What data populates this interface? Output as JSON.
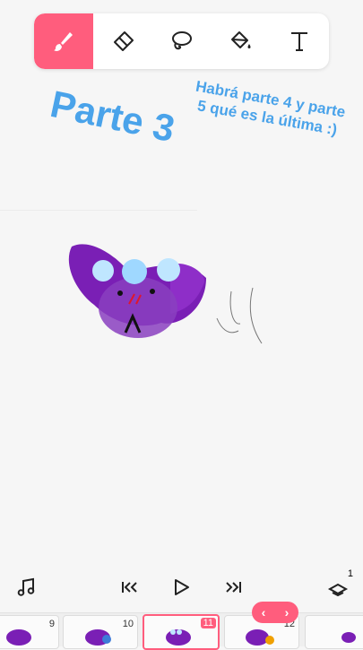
{
  "toolbar": {
    "tools": [
      {
        "icon": "brush-icon",
        "active": true
      },
      {
        "icon": "eraser-icon",
        "active": false
      },
      {
        "icon": "lasso-icon",
        "active": false
      },
      {
        "icon": "fill-bucket-icon",
        "active": false
      },
      {
        "icon": "text-tool-icon",
        "active": false
      }
    ],
    "accent": "#ff5d7d"
  },
  "overlay": {
    "title": "Parte 3",
    "note": "Habrá parte 4 y parte 5 qué es la última :)",
    "color": "#4aa3ea"
  },
  "controls": {
    "music": "music-note-icon",
    "previous": "skip-back-icon",
    "play": "play-icon",
    "next": "skip-forward-icon",
    "layers": "layers-icon",
    "layers_count": "1"
  },
  "frames": [
    {
      "number": "9",
      "current": false
    },
    {
      "number": "10",
      "current": false
    },
    {
      "number": "11",
      "current": true
    },
    {
      "number": "12",
      "current": false
    },
    {
      "number": "",
      "current": false
    }
  ],
  "frame_nav": {
    "prev": "‹",
    "next": "›"
  }
}
